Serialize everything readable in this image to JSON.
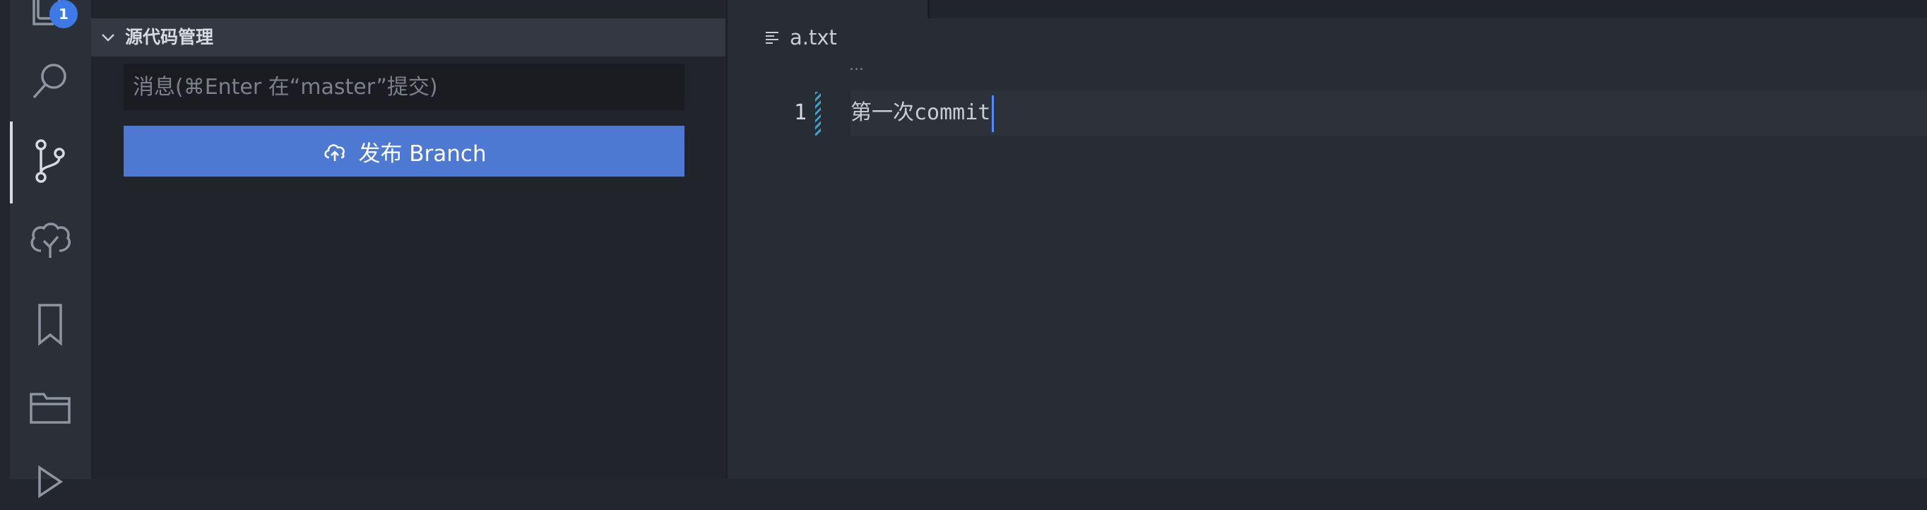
{
  "activity_bar": {
    "explorer_badge": "1",
    "icons": [
      "files-icon",
      "search-icon",
      "source-control-icon",
      "tree-icon",
      "bookmark-icon",
      "folder-icon",
      "run-icon"
    ]
  },
  "scm": {
    "section_title": "源代码管理",
    "message_placeholder": "消息(⌘Enter 在“master”提交)",
    "publish_label": "发布 Branch"
  },
  "editor": {
    "file_name": "a.txt",
    "fold_dots": "...",
    "line_number": "1",
    "line_text": "第一次commit"
  },
  "colors": {
    "accent": "#4e79d3",
    "badge": "#3d7ae8",
    "cursor": "#528bff",
    "diff_marker": "#3fa0c8"
  }
}
